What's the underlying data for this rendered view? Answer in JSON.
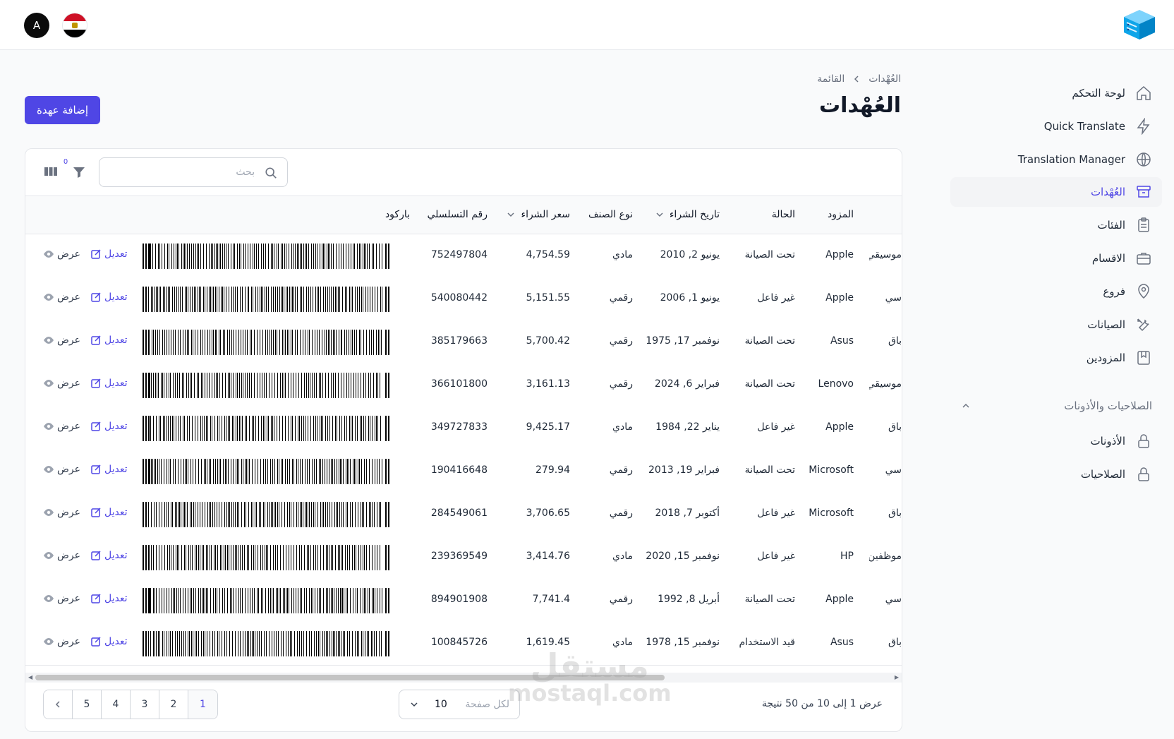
{
  "header": {
    "avatar_letter": "A",
    "logo_icon": "server-cube-icon",
    "flag_icon": "egypt-flag-icon"
  },
  "sidebar": {
    "items": [
      {
        "label": "لوحة التحكم",
        "icon": "home-icon"
      },
      {
        "label": "Quick Translate",
        "icon": "bolt-icon"
      },
      {
        "label": "Translation Manager",
        "icon": "globe-icon"
      },
      {
        "label": "العُهْدات",
        "icon": "archive-box-icon",
        "active": true
      },
      {
        "label": "الفئات",
        "icon": "clipboard-icon"
      },
      {
        "label": "الاقسام",
        "icon": "briefcase-icon"
      },
      {
        "label": "فروع",
        "icon": "map-pin-icon"
      },
      {
        "label": "الصيانات",
        "icon": "tools-icon"
      },
      {
        "label": "المزودين",
        "icon": "bookmark-book-icon"
      }
    ],
    "group": {
      "label": "الصلاحيات والأذونات",
      "expanded": true
    },
    "group_items": [
      {
        "label": "الأذونات",
        "icon": "lock-icon"
      },
      {
        "label": "الصلاحيات",
        "icon": "lock-icon"
      }
    ]
  },
  "breadcrumb": {
    "root": "العُهْدات",
    "current": "القائمة"
  },
  "page": {
    "title": "العُهْدات",
    "add_button": "إضافة عهدة"
  },
  "toolbar": {
    "search_placeholder": "بحث",
    "filter_count": "0"
  },
  "table": {
    "columns": {
      "supplier": "المزود",
      "status": "الحالة",
      "purchase_date": "تاريخ الشراء",
      "item_type": "نوع الصنف",
      "purchase_price": "سعر الشراء",
      "serial_number": "رقم التسلسلي",
      "barcode": "باركود"
    },
    "edit_label": "تعديل",
    "view_label": "عرض",
    "rows": [
      {
        "first": "موسيقي",
        "supplier": "Apple",
        "status": "تحت الصيانة",
        "date": "يونيو 2, 2010",
        "type": "مادي",
        "price": "4,754.59",
        "serial": "752497804"
      },
      {
        "first": "سي",
        "supplier": "Apple",
        "status": "غير فاعل",
        "date": "يونيو 1, 2006",
        "type": "رقمي",
        "price": "5,151.55",
        "serial": "540080442"
      },
      {
        "first": "باق",
        "supplier": "Asus",
        "status": "تحت الصيانة",
        "date": "نوفمبر 17, 1975",
        "type": "رقمي",
        "price": "5,700.42",
        "serial": "385179663"
      },
      {
        "first": "موسيقي",
        "supplier": "Lenovo",
        "status": "تحت الصيانة",
        "date": "فبراير 6, 2024",
        "type": "رقمي",
        "price": "3,161.13",
        "serial": "366101800"
      },
      {
        "first": "باق",
        "supplier": "Apple",
        "status": "غير فاعل",
        "date": "يناير 22, 1984",
        "type": "مادي",
        "price": "9,425.17",
        "serial": "349727833"
      },
      {
        "first": "سي",
        "supplier": "Microsoft",
        "status": "تحت الصيانة",
        "date": "فبراير 19, 2013",
        "type": "رقمي",
        "price": "279.94",
        "serial": "190416648"
      },
      {
        "first": "باق",
        "supplier": "Microsoft",
        "status": "غير فاعل",
        "date": "أكتوبر 7, 2018",
        "type": "رقمي",
        "price": "3,706.65",
        "serial": "284549061"
      },
      {
        "first": "موظفين",
        "supplier": "HP",
        "status": "غير فاعل",
        "date": "نوفمبر 15, 2020",
        "type": "مادي",
        "price": "3,414.76",
        "serial": "239369549"
      },
      {
        "first": "سي",
        "supplier": "Apple",
        "status": "تحت الصيانة",
        "date": "أبريل 8, 1992",
        "type": "رقمي",
        "price": "7,741.4",
        "serial": "894901908"
      },
      {
        "first": "باق",
        "supplier": "Asus",
        "status": "قيد الاستخدام",
        "date": "نوفمبر 15, 1978",
        "type": "مادي",
        "price": "1,619.45",
        "serial": "100845726"
      }
    ]
  },
  "footer": {
    "summary": "عرض 1 إلى 10 من 50 نتيجة",
    "per_page_label": "لكل صفحة",
    "per_page_value": "10",
    "pages": [
      "1",
      "2",
      "3",
      "4",
      "5"
    ],
    "active_page": "1"
  },
  "watermark": {
    "arabic": "مستقل",
    "latin": "mostaql.com"
  },
  "colors": {
    "accent": "#4f46e5",
    "border": "#e5e7eb",
    "text": "#111827"
  }
}
